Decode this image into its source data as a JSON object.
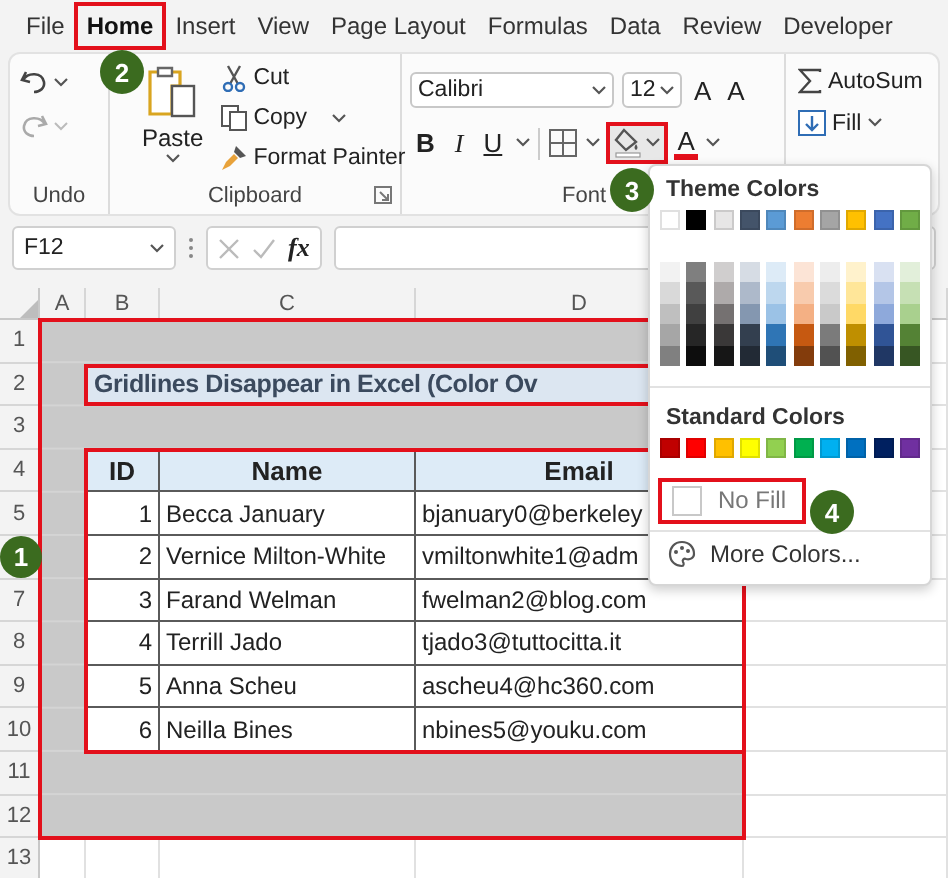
{
  "menu_tabs": [
    {
      "label": "File",
      "selected": false,
      "highlighted": false
    },
    {
      "label": "Home",
      "selected": true,
      "highlighted": true,
      "step": "2"
    },
    {
      "label": "Insert",
      "selected": false,
      "highlighted": false
    },
    {
      "label": "View",
      "selected": false,
      "highlighted": false
    },
    {
      "label": "Page Layout",
      "selected": false,
      "highlighted": false
    },
    {
      "label": "Formulas",
      "selected": false,
      "highlighted": false
    },
    {
      "label": "Data",
      "selected": false,
      "highlighted": false
    },
    {
      "label": "Review",
      "selected": false,
      "highlighted": false
    },
    {
      "label": "Developer",
      "selected": false,
      "highlighted": false
    }
  ],
  "ribbon": {
    "undo": {
      "label": "Undo"
    },
    "clipboard": {
      "label": "Clipboard",
      "paste": "Paste",
      "cut": "Cut",
      "copy": "Copy",
      "format_painter": "Format Painter"
    },
    "font": {
      "label": "Font",
      "font_name": "Calibri",
      "font_size": "12",
      "size_buttons": [
        "A",
        "A"
      ],
      "style_buttons": [
        "B",
        "I",
        "U"
      ],
      "fill_color": {
        "highlighted": true,
        "step": "3"
      },
      "font_color": "A"
    },
    "editing": {
      "autosum": "AutoSum",
      "fill": "Fill"
    }
  },
  "formula_bar": {
    "name_box": "F12",
    "function_label": "fx"
  },
  "sheet": {
    "columns": [
      "A",
      "B",
      "C",
      "D"
    ],
    "rows": [
      {
        "label": "1"
      },
      {
        "label": "2"
      },
      {
        "label": "3"
      },
      {
        "label": "4"
      },
      {
        "label": "5"
      },
      {},
      {
        "label": "7"
      },
      {
        "label": "8"
      },
      {
        "label": "9"
      },
      {
        "label": "10"
      },
      {
        "label": "11"
      },
      {
        "label": "12"
      },
      {
        "label": "13"
      }
    ],
    "filled_range": {
      "filled": true,
      "highlighted": true,
      "step": "1"
    },
    "title": {
      "text": "Gridlines Disappear in Excel (Color Ov",
      "highlighted": true
    },
    "table": {
      "highlighted": true,
      "header": [
        "ID",
        "Name",
        "Email"
      ],
      "rows": [
        [
          "1",
          "Becca January",
          "bjanuary0@berkeley"
        ],
        [
          "2",
          "Vernice Milton-White",
          "vmiltonwhite1@adm"
        ],
        [
          "3",
          "Farand Welman",
          "fwelman2@blog.com"
        ],
        [
          "4",
          "Terrill Jado",
          "tjado3@tuttocitta.it"
        ],
        [
          "5",
          "Anna Scheu",
          "ascheu4@hc360.com"
        ],
        [
          "6",
          "Neilla Bines",
          "nbines5@youku.com"
        ]
      ]
    }
  },
  "fill_menu": {
    "theme_title": "Theme Colors",
    "theme_colors": [
      {
        "color": "#ffffff"
      },
      {
        "color": "#000000"
      },
      {
        "color": "#e7e6e6"
      },
      {
        "color": "#44546a"
      },
      {
        "color": "#5b9bd5"
      },
      {
        "color": "#ed7d31"
      },
      {
        "color": "#a5a5a5"
      },
      {
        "color": "#ffc000"
      },
      {
        "color": "#4472c4"
      },
      {
        "color": "#70ad47"
      }
    ],
    "shade_rows": [
      [
        {
          "color": "#f2f2f2"
        },
        {
          "color": "#7f7f7f"
        },
        {
          "color": "#d0cece"
        },
        {
          "color": "#d6dce4"
        },
        {
          "color": "#ddebf7"
        },
        {
          "color": "#fce4d6"
        },
        {
          "color": "#ededed"
        },
        {
          "color": "#fff2cc"
        },
        {
          "color": "#d9e1f2"
        },
        {
          "color": "#e2efda"
        }
      ],
      [
        {
          "color": "#d9d9d9"
        },
        {
          "color": "#595959"
        },
        {
          "color": "#aeaaaa"
        },
        {
          "color": "#adb9ca"
        },
        {
          "color": "#bdd7ee"
        },
        {
          "color": "#f8cbad"
        },
        {
          "color": "#dbdbdb"
        },
        {
          "color": "#ffe699"
        },
        {
          "color": "#b4c6e7"
        },
        {
          "color": "#c6e0b4"
        }
      ],
      [
        {
          "color": "#bfbfbf"
        },
        {
          "color": "#404040"
        },
        {
          "color": "#757171"
        },
        {
          "color": "#8497b0"
        },
        {
          "color": "#9bc2e6"
        },
        {
          "color": "#f4b084"
        },
        {
          "color": "#c9c9c9"
        },
        {
          "color": "#ffd966"
        },
        {
          "color": "#8ea9db"
        },
        {
          "color": "#a9d08e"
        }
      ],
      [
        {
          "color": "#a6a6a6"
        },
        {
          "color": "#262626"
        },
        {
          "color": "#3a3838"
        },
        {
          "color": "#333f4f"
        },
        {
          "color": "#2f75b5"
        },
        {
          "color": "#c65911"
        },
        {
          "color": "#7b7b7b"
        },
        {
          "color": "#bf8f00"
        },
        {
          "color": "#305496"
        },
        {
          "color": "#548235"
        }
      ],
      [
        {
          "color": "#808080"
        },
        {
          "color": "#0d0d0d"
        },
        {
          "color": "#161616"
        },
        {
          "color": "#222a35"
        },
        {
          "color": "#1f4e78"
        },
        {
          "color": "#833c0c"
        },
        {
          "color": "#525252"
        },
        {
          "color": "#806000"
        },
        {
          "color": "#203764"
        },
        {
          "color": "#375623"
        }
      ]
    ],
    "standard_title": "Standard Colors",
    "standard_colors": [
      {
        "color": "#c00000"
      },
      {
        "color": "#ff0000"
      },
      {
        "color": "#ffc000"
      },
      {
        "color": "#ffff00"
      },
      {
        "color": "#92d050"
      },
      {
        "color": "#00b050"
      },
      {
        "color": "#00b0f0"
      },
      {
        "color": "#0070c0"
      },
      {
        "color": "#002060"
      },
      {
        "color": "#7030a0"
      }
    ],
    "no_fill": {
      "label": "No Fill",
      "highlighted": true,
      "step": "4"
    },
    "more_colors": "More Colors..."
  }
}
